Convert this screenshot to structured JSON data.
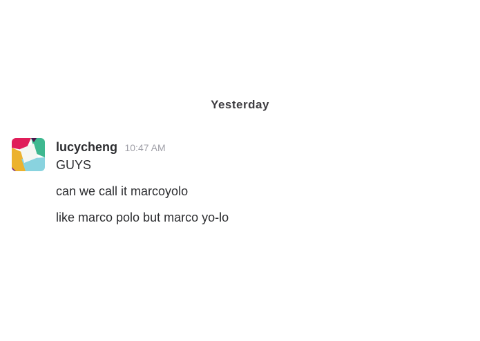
{
  "divider": {
    "label": "Yesterday"
  },
  "message_group": {
    "avatar_icon": "slack-logo-avatar",
    "username": "lucycheng",
    "timestamp": "10:47 AM",
    "messages": [
      {
        "text": "GUYS"
      },
      {
        "text": "can we call it marcoyolo"
      },
      {
        "text": "like marco polo but marco yo-lo"
      }
    ]
  },
  "colors": {
    "avatar_pink": "#e01e5a",
    "avatar_teal": "#36c5ab",
    "avatar_yellow": "#ecb22e",
    "avatar_blue": "#89d3df",
    "avatar_green": "#3eb890"
  }
}
